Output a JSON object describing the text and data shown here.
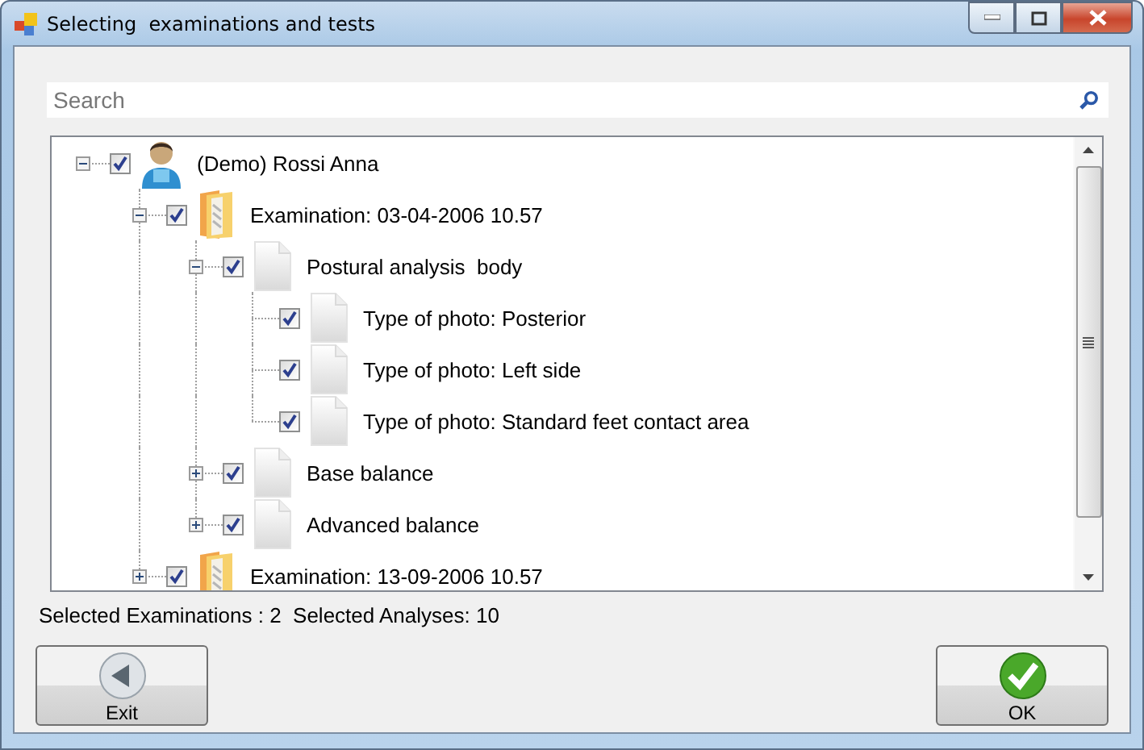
{
  "window": {
    "title": "Selecting  examinations and tests"
  },
  "search": {
    "placeholder": "Search"
  },
  "tree": [
    {
      "kind": "person",
      "label": "(Demo) Rossi Anna",
      "checked": true,
      "expanded": true,
      "children": [
        {
          "kind": "folder",
          "label": "Examination: 03-04-2006 10.57",
          "checked": true,
          "expanded": true,
          "children": [
            {
              "kind": "document",
              "label": "Postural analysis  body",
              "checked": true,
              "expanded": true,
              "children": [
                {
                  "kind": "document",
                  "label": "Type of photo: Posterior",
                  "checked": true
                },
                {
                  "kind": "document",
                  "label": "Type of photo: Left side",
                  "checked": true
                },
                {
                  "kind": "document",
                  "label": "Type of photo: Standard feet contact area",
                  "checked": true
                }
              ]
            },
            {
              "kind": "document",
              "label": "Base balance",
              "checked": true,
              "expanded": false
            },
            {
              "kind": "document",
              "label": "Advanced balance",
              "checked": true,
              "expanded": false
            }
          ]
        },
        {
          "kind": "folder",
          "label": "Examination: 13-09-2006 10.57",
          "checked": true,
          "expanded": false
        }
      ]
    }
  ],
  "status": "Selected Examinations : 2  Selected Analyses: 10",
  "buttons": [
    {
      "kind": "back",
      "label": "Exit"
    },
    {
      "kind": "ok",
      "label": "OK"
    }
  ]
}
